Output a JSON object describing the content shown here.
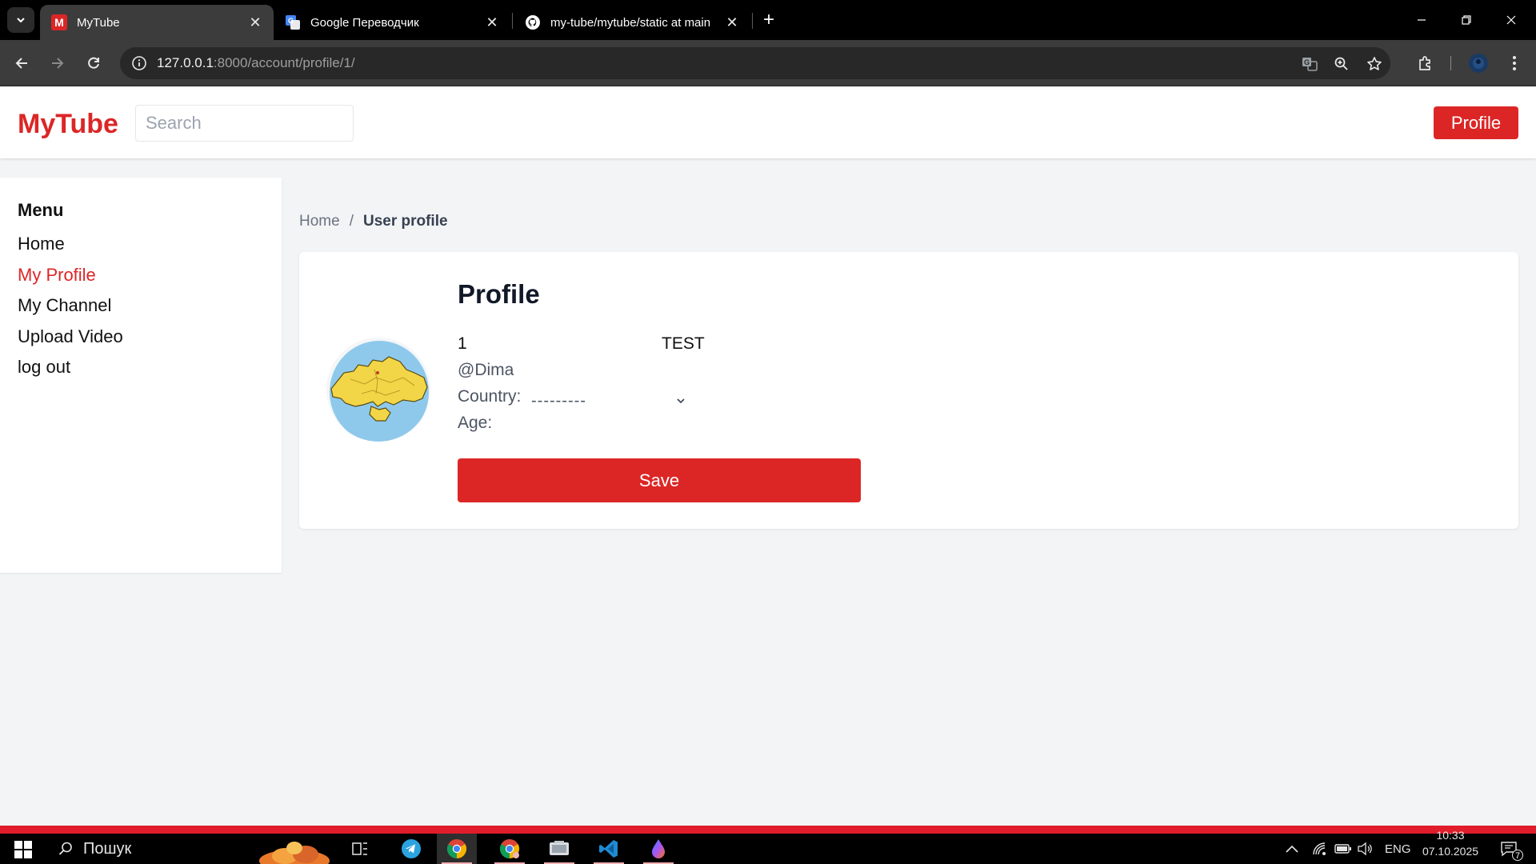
{
  "browser": {
    "tabs": [
      {
        "title": "MyTube",
        "favicon": "mytube-favicon",
        "active": true
      },
      {
        "title": "Google Переводчик",
        "favicon": "google-translate-favicon",
        "active": false
      },
      {
        "title": "my-tube/mytube/static at main",
        "favicon": "github-favicon",
        "active": false
      }
    ],
    "url_host": "127.0.0.1",
    "url_path": ":8000/account/profile/1/"
  },
  "header": {
    "logo": "MyTube",
    "search_placeholder": "Search",
    "profile_button": "Profile"
  },
  "sidebar": {
    "title": "Menu",
    "items": [
      {
        "label": "Home",
        "active": false
      },
      {
        "label": "My Profile",
        "active": true
      },
      {
        "label": "My Channel",
        "active": false
      },
      {
        "label": "Upload Video",
        "active": false
      },
      {
        "label": "log out",
        "active": false
      }
    ]
  },
  "breadcrumb": {
    "home": "Home",
    "separator": "/",
    "current": "User profile"
  },
  "profile": {
    "title": "Profile",
    "id": "1",
    "name": "TEST",
    "username": "@Dima",
    "country_label": "Country:",
    "country_value": "---------",
    "age_label": "Age:",
    "save_button": "Save"
  },
  "taskbar": {
    "search_label": "Пошук",
    "language": "ENG",
    "time": "10:33",
    "date": "07.10.2025",
    "notifications": "7"
  },
  "colors": {
    "accent": "#dc2626",
    "page_bg": "#f3f4f6",
    "chrome_dark": "#3c3c3c"
  }
}
